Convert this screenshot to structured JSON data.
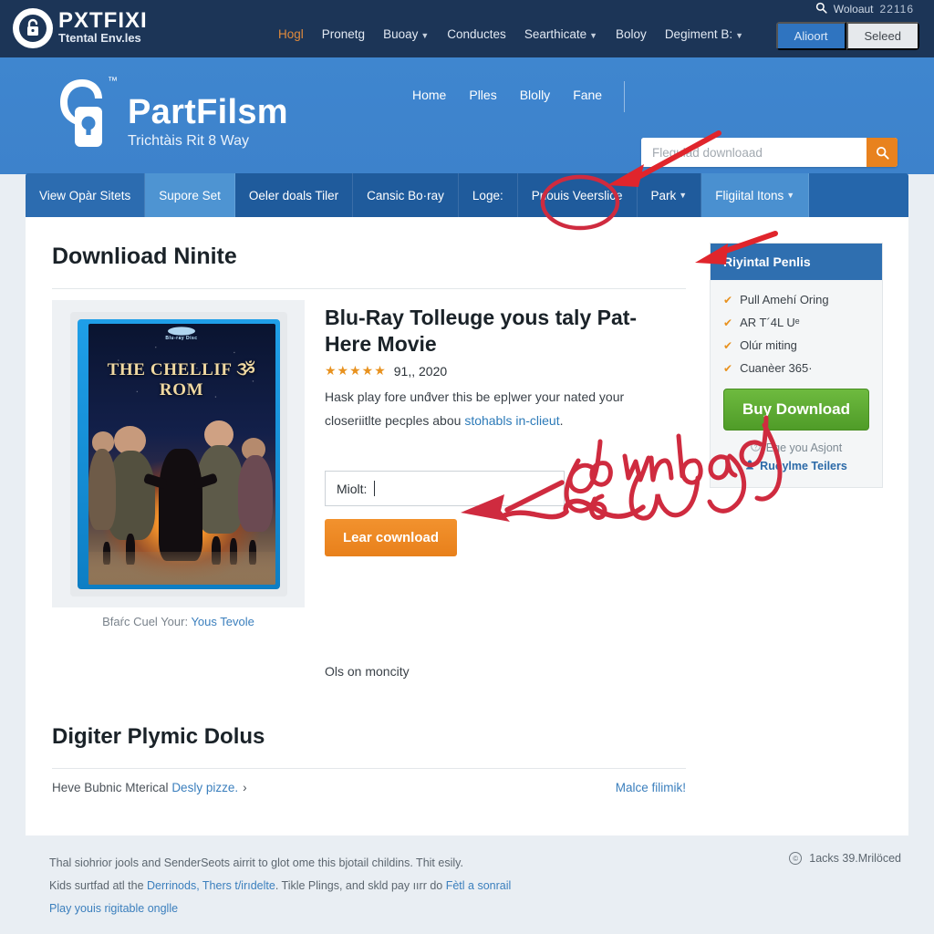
{
  "topbar": {
    "brand_name": "PXTFIXI",
    "brand_tagline": "Ttental Env.les",
    "search_icon": "search-icon",
    "account_label": "Woloaut",
    "account_number": "22116",
    "nav": [
      {
        "label": "Hogl",
        "caret": false,
        "active": true
      },
      {
        "label": "Pronetg",
        "caret": false,
        "active": false
      },
      {
        "label": "Buoay",
        "caret": true,
        "active": false
      },
      {
        "label": "Conductes",
        "caret": false,
        "active": false
      },
      {
        "label": "Searthicate",
        "caret": true,
        "active": false
      },
      {
        "label": "Boloy",
        "caret": false,
        "active": false
      },
      {
        "label": "Degiment B:",
        "caret": true,
        "active": false
      }
    ],
    "primary_button": "Alioort",
    "ghost_button": "Seleed"
  },
  "header": {
    "logo_title": "PartFilsm",
    "logo_sub": "Trichtàis Rit 8 Way",
    "logo_tm": "™",
    "nav": [
      {
        "label": "Home"
      },
      {
        "label": "Plles"
      },
      {
        "label": "Blolly"
      },
      {
        "label": "Fane"
      }
    ],
    "search": {
      "placeholder": "Flegulad downloaad",
      "value": "",
      "button_icon": "search-icon"
    }
  },
  "tabs": [
    {
      "label": "View Opàr Sitets",
      "style": "blue-dark",
      "caret": false
    },
    {
      "label": "Supore Set",
      "style": "sel",
      "caret": false
    },
    {
      "label": "Oeler doals Tiler",
      "style": "blue-mid",
      "caret": false
    },
    {
      "label": "Cansic Bo·ray",
      "style": "blue-mid",
      "caret": false
    },
    {
      "label": "Loge:",
      "style": "blue-mid",
      "caret": false
    },
    {
      "label": "Pnouis Veerslice",
      "style": "blue-mid",
      "caret": false
    },
    {
      "label": "Park",
      "style": "blue-mid",
      "caret": true
    },
    {
      "label": "Fligiital Itons",
      "style": "blue-lt",
      "caret": true
    }
  ],
  "main": {
    "page_title": "Downlioad Ninite",
    "product": {
      "cover": {
        "bd_logo": "Blu-ray Disc",
        "art_title": "THE CHELLIF ૐ ROM"
      },
      "title": "Blu-Ray Tolleuge yous taly Pat-Here Movie",
      "stars": "★★★★★",
      "rating_meta": "91,, 2020",
      "desc_line1": "Hask play fore und́ver this be ep|wer your nated your",
      "desc_line2_pre": "closeriitlte pecples abou ",
      "desc_link": "stohabls in-clieut",
      "desc_line2_post": ".",
      "field_label": "Ols on moncity",
      "field_value": "Miolt:",
      "submit_button": "Lear cownload",
      "under_cover_text": "Bfaŕc Cuel Your: ",
      "under_cover_link": "Yous Tevole"
    },
    "sidecard": {
      "heading": "Riyintal Penlis",
      "features": [
        {
          "check": "✔",
          "label": "Pull Amehí Oring"
        },
        {
          "check": "✔",
          "label": "AR T´4L Uᵉ"
        },
        {
          "check": "✔",
          "label": "Olúr miting"
        },
        {
          "check": "✔",
          "label": "Cuanèer 365·"
        }
      ],
      "buy_button": "Buy Download",
      "link_muted_icon": "question-circle-icon",
      "link_muted": "Ege you Asjont",
      "link_bold_icon": "person-icon",
      "link_bold": "Ruoylme Teilers"
    },
    "section": {
      "title": "Digiter Plymic Dolus",
      "left_text_pre": "Heve Bubnic Mterical ",
      "left_link": "Desly pizze.",
      "left_chevron": "›",
      "right_link": "Malce filimik!"
    }
  },
  "footer": {
    "line1": "Thal siohrior jools and SenderSeots airrit to glot ome this bjotail childins. Thit esily.",
    "line2_pre": "Kids surtfad atl the ",
    "line2_link1": "Derrinods, Thers t/irıdelte",
    "line2_mid": ". Tikle Plings, and skld pay ıırr do ",
    "line2_link2": "Fètl a sonrail",
    "line3_link": "Play youis rigitable onglle",
    "badge_icon": "copyright-icon",
    "badge_text": "1acks 39.Mrilöced"
  },
  "annotations": {
    "handwriting": "download",
    "color": "#cf2b3f",
    "circle_target": "tab-pnouis-veerslice",
    "arrow1_target": "tab-strip",
    "arrow2_target": "sidecard",
    "arrow3_target": "submit-button"
  },
  "colors": {
    "topbar": "#1c3557",
    "header_blue": "#3f86cf",
    "tab_blue": "#1f5b9c",
    "accent_orange": "#e8821e",
    "accent_green": "#5aa82f",
    "link_blue": "#3b7fbd",
    "anno_red": "#cf2b3f"
  }
}
